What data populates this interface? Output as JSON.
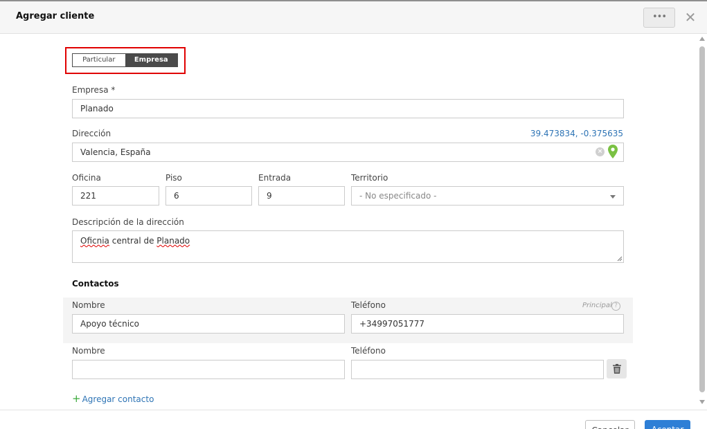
{
  "dialog": {
    "title": "Agregar cliente",
    "more_label": "•••",
    "close_label": "✕"
  },
  "client_type": {
    "options": [
      "Particular",
      "Empresa"
    ],
    "selected": "Empresa",
    "highlight_color": "#e00000"
  },
  "form": {
    "empresa": {
      "label": "Empresa *",
      "value": "Planado"
    },
    "direccion": {
      "label": "Dirección",
      "value": "Valencia, España",
      "coords": "39.473834, -0.375635",
      "pin_color": "#7ac143"
    },
    "oficina": {
      "label": "Oficina",
      "value": "221"
    },
    "piso": {
      "label": "Piso",
      "value": "6"
    },
    "entrada": {
      "label": "Entrada",
      "value": "9"
    },
    "territorio": {
      "label": "Territorio",
      "value": "- No especificado -"
    },
    "descripcion": {
      "label": "Descripción de la dirección",
      "words": [
        "Oficnia",
        "central de",
        "Planado"
      ]
    }
  },
  "contacts": {
    "title": "Contactos",
    "principal_label": "Principal",
    "rows": [
      {
        "name_label": "Nombre",
        "name_value": "Apoyo técnico",
        "phone_label": "Teléfono",
        "phone_value": "+34997051777"
      },
      {
        "name_label": "Nombre",
        "name_value": "",
        "phone_label": "Teléfono",
        "phone_value": ""
      }
    ],
    "add_label": "Agregar contacto"
  },
  "footer": {
    "cancel_label": "Cancelar",
    "accept_label": "Aceptar",
    "accent_color": "#2e7fd6"
  }
}
